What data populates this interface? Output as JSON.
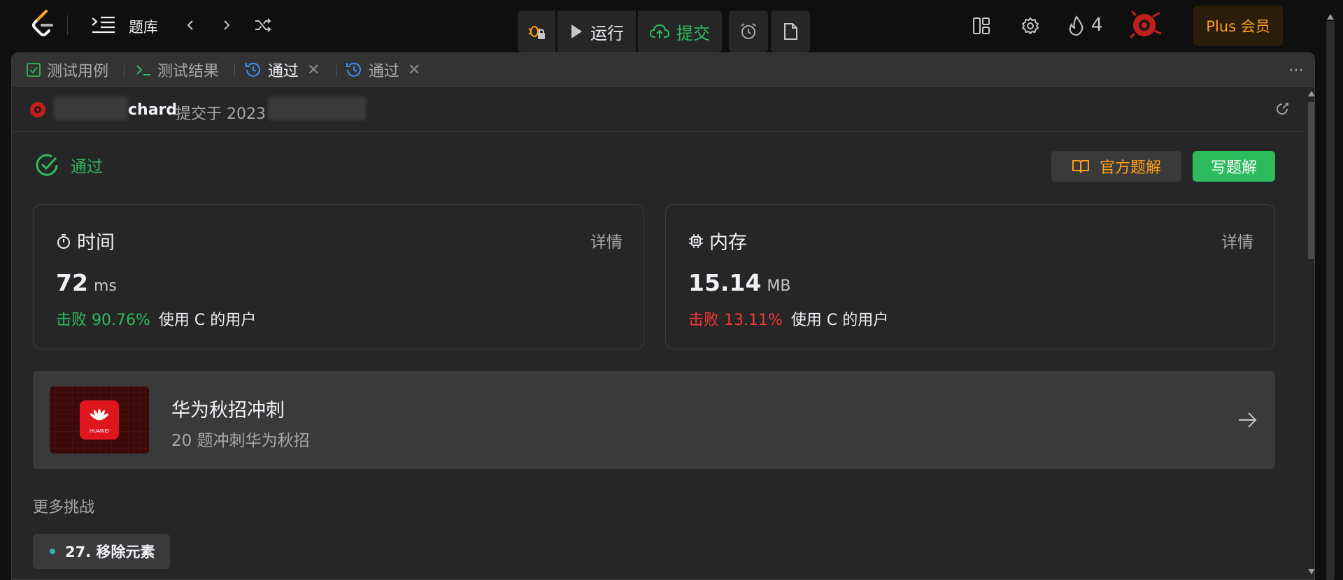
{
  "topbar": {
    "problems_label": "题库",
    "run_label": "运行",
    "submit_label": "提交",
    "streak_count": "4",
    "plus_label": "Plus 会员"
  },
  "tabs": {
    "testcase": "测试用例",
    "test_result": "测试结果",
    "accepted_1": "通过",
    "accepted_2": "通过",
    "close_glyph": "✕",
    "more_glyph": "⋯"
  },
  "submission": {
    "user_visible": "chard",
    "submitted_at_label": "提交于 2023"
  },
  "result": {
    "status": "通过",
    "official_solution": "官方题解",
    "write_solution": "写题解"
  },
  "runtime": {
    "title": "时间",
    "detail": "详情",
    "value": "72",
    "unit": "ms",
    "beats": "击败 90.76%",
    "beats_color": "#2cbb5d",
    "who": "使用 C 的用户"
  },
  "memory": {
    "title": "内存",
    "detail": "详情",
    "value": "15.14",
    "unit": "MB",
    "beats": "击败 13.11%",
    "beats_color": "#f63636",
    "who": "使用 C 的用户"
  },
  "promo": {
    "title": "华为秋招冲刺",
    "subtitle": "20 题冲刺华为秋招",
    "logo_text": "HUAWEI"
  },
  "more": {
    "label": "更多挑战",
    "items": [
      {
        "label": "27. 移除元素"
      }
    ]
  },
  "colors": {
    "accent_green": "#2cbb5d",
    "accent_orange": "#ffa116",
    "danger_red": "#f63636",
    "link_blue": "#3c8ef7"
  },
  "icons": {
    "logo": "leetcode-logo",
    "problem_list": "list-icon",
    "prev": "chevron-left-icon",
    "next": "chevron-right-icon",
    "random": "shuffle-icon",
    "debug": "bug-lock-icon",
    "run": "play-icon",
    "submit": "cloud-upload-icon",
    "timer": "alarm-icon",
    "notes": "note-icon",
    "layout": "layout-icon",
    "settings": "gear-icon",
    "streak": "flame-icon"
  }
}
